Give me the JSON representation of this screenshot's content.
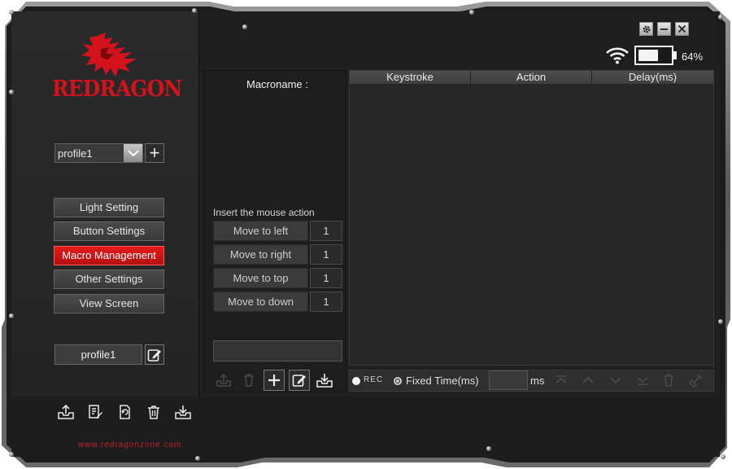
{
  "brand": {
    "logo_text": "REDRAGON",
    "website": "www.redragonzone.com"
  },
  "profile": {
    "selected": "profile1",
    "name": "profile1"
  },
  "nav": {
    "items": [
      {
        "label": "Light Setting",
        "active": false
      },
      {
        "label": "Button Settings",
        "active": false
      },
      {
        "label": "Macro Management",
        "active": true
      },
      {
        "label": "Other Settings",
        "active": false
      },
      {
        "label": "View Screen",
        "active": false
      }
    ]
  },
  "status": {
    "battery_percent": 64,
    "battery_label": "64%",
    "wireless_icon": "wifi-icon"
  },
  "macro": {
    "name_label": "Macroname :",
    "insert_mouse_label": "Insert the mouse action",
    "mouse_actions": [
      {
        "label": "Move to left",
        "value": "1"
      },
      {
        "label": "Move to right",
        "value": "1"
      },
      {
        "label": "Move to top",
        "value": "1"
      },
      {
        "label": "Move to down",
        "value": "1"
      }
    ],
    "name_input_value": ""
  },
  "table": {
    "columns": [
      "Keystroke",
      "Action",
      "Delay(ms)"
    ],
    "rows": []
  },
  "record": {
    "rec_label": "REC",
    "fixed_time_label": "Fixed Time(ms)",
    "ms_value": "",
    "ms_unit": "ms"
  },
  "colors": {
    "accent": "#d4121c",
    "active_button": "#d41717",
    "background": "#1c1c1c"
  }
}
